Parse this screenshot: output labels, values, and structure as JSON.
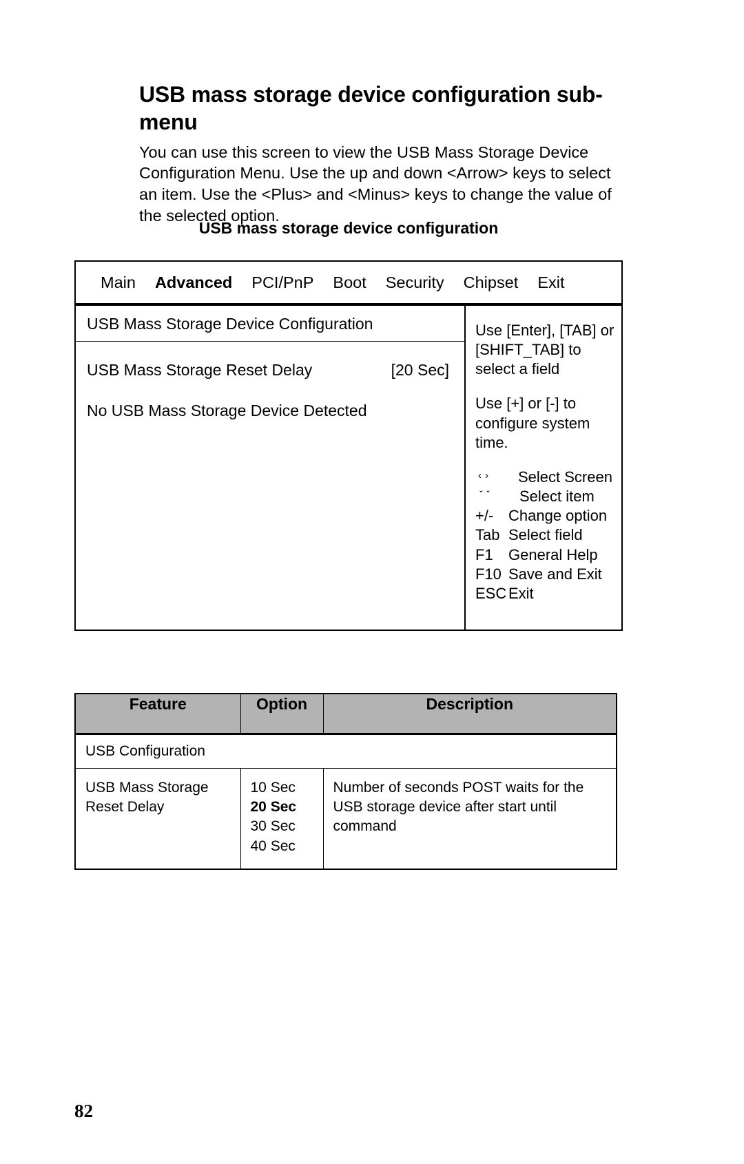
{
  "document": {
    "heading": "USB mass storage device configuration sub-menu",
    "intro": "You can use this screen to view the USB Mass Storage Device Configuration Menu. Use the up and down <Arrow> keys to select an item. Use the <Plus> and <Minus> keys to change the value of the selected option.",
    "screen_caption": "USB mass storage device configuration",
    "page_number": "82"
  },
  "bios": {
    "tabs": [
      {
        "label": "Main",
        "active": false
      },
      {
        "label": "Advanced",
        "active": true
      },
      {
        "label": "PCI/PnP",
        "active": false
      },
      {
        "label": "Boot",
        "active": false
      },
      {
        "label": "Security",
        "active": false
      },
      {
        "label": "Chipset",
        "active": false
      },
      {
        "label": "Exit",
        "active": false
      }
    ],
    "section_title": "USB Mass Storage Device Configuration",
    "settings": [
      {
        "label": "USB Mass Storage Reset Delay",
        "value": "[20 Sec]"
      }
    ],
    "status_note": "No USB Mass Storage Device Detected",
    "help": {
      "paragraph1": "Use [Enter], [TAB] or [SHIFT_TAB] to select a field",
      "paragraph2": "Use [+] or [-] to configure system time.",
      "keys": [
        {
          "key": "‹›",
          "desc": "Select Screen"
        },
        {
          "key": "ˇˇ",
          "desc": "Select item"
        },
        {
          "key": "+/-",
          "desc": "Change option"
        },
        {
          "key": "Tab",
          "desc": "Select field"
        },
        {
          "key": "F1",
          "desc": "General Help"
        },
        {
          "key": "F10",
          "desc": "Save and Exit"
        },
        {
          "key": "ESC",
          "desc": "Exit"
        }
      ]
    }
  },
  "feature_table": {
    "headers": [
      "Feature",
      "Option",
      "Description"
    ],
    "group_row": "USB Configuration",
    "rows": [
      {
        "feature": "USB Mass Storage Reset Delay",
        "options": [
          {
            "label": "10 Sec",
            "selected": false
          },
          {
            "label": "20 Sec",
            "selected": true
          },
          {
            "label": "30 Sec",
            "selected": false
          },
          {
            "label": "40 Sec",
            "selected": false
          }
        ],
        "description": "Number of seconds POST waits for the USB storage device after start until command"
      }
    ]
  },
  "colors": {
    "header_fill": "#b3b3b3",
    "text": "#000000",
    "background": "#ffffff"
  }
}
